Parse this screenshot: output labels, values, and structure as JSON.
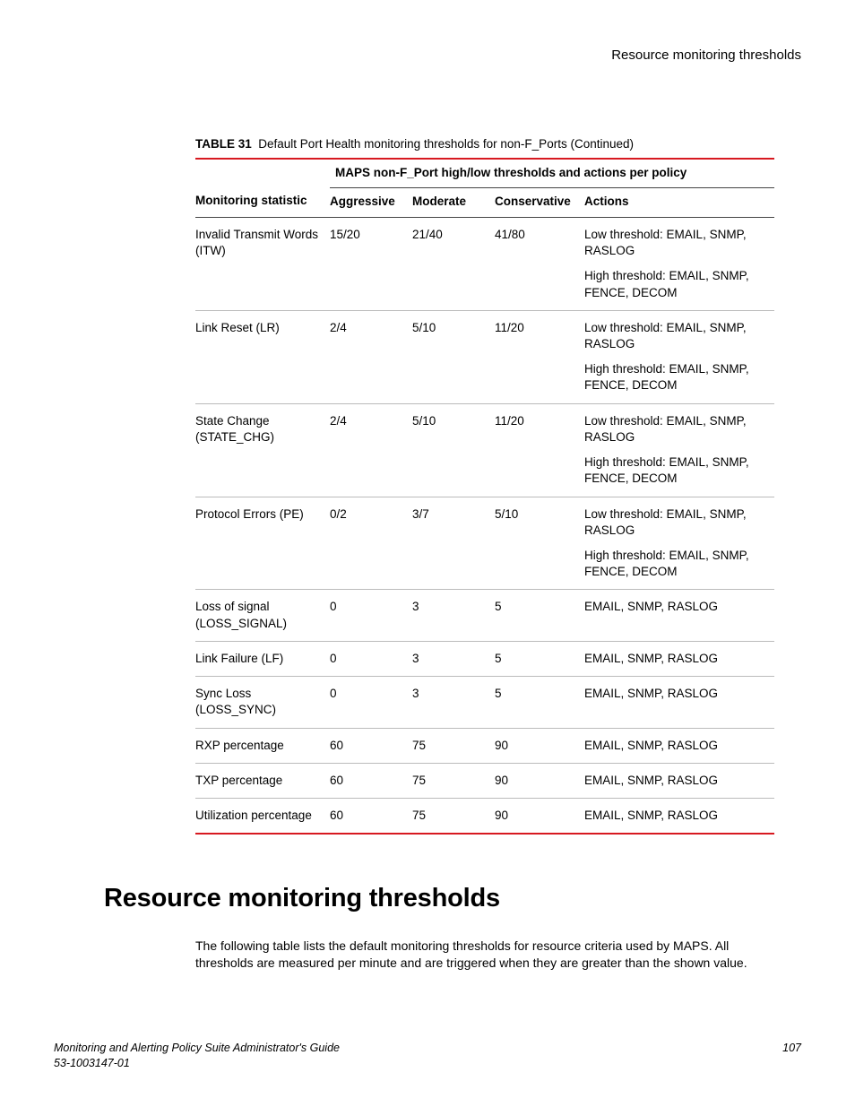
{
  "running_head": "Resource monitoring thresholds",
  "table_caption_label": "TABLE 31",
  "table_caption_text": "Default Port Health monitoring thresholds for non-F_Ports (Continued)",
  "super_header": "MAPS non-F_Port high/low thresholds and actions per policy",
  "columns": {
    "stat": "Monitoring statistic",
    "aggressive": "Aggressive",
    "moderate": "Moderate",
    "conservative": "Conservative",
    "actions": "Actions"
  },
  "actions_two_line": {
    "low": "Low threshold: EMAIL, SNMP, RASLOG",
    "high": "High threshold: EMAIL, SNMP, FENCE, DECOM"
  },
  "actions_single": "EMAIL, SNMP, RASLOG",
  "rows": [
    {
      "stat": "Invalid Transmit Words (ITW)",
      "aggressive": "15/20",
      "moderate": "21/40",
      "conservative": "41/80",
      "two": true
    },
    {
      "stat": "Link Reset (LR)",
      "aggressive": "2/4",
      "moderate": "5/10",
      "conservative": "11/20",
      "two": true
    },
    {
      "stat": "State Change (STATE_CHG)",
      "aggressive": "2/4",
      "moderate": "5/10",
      "conservative": "11/20",
      "two": true
    },
    {
      "stat": "Protocol Errors (PE)",
      "aggressive": "0/2",
      "moderate": "3/7",
      "conservative": "5/10",
      "two": true
    },
    {
      "stat": "Loss of signal (LOSS_SIGNAL)",
      "aggressive": "0",
      "moderate": "3",
      "conservative": "5",
      "two": false
    },
    {
      "stat": "Link Failure (LF)",
      "aggressive": "0",
      "moderate": "3",
      "conservative": "5",
      "two": false
    },
    {
      "stat": "Sync Loss (LOSS_SYNC)",
      "aggressive": "0",
      "moderate": "3",
      "conservative": "5",
      "two": false
    },
    {
      "stat": "RXP percentage",
      "aggressive": "60",
      "moderate": "75",
      "conservative": "90",
      "two": false
    },
    {
      "stat": "TXP percentage",
      "aggressive": "60",
      "moderate": "75",
      "conservative": "90",
      "two": false
    },
    {
      "stat": "Utilization percentage",
      "aggressive": "60",
      "moderate": "75",
      "conservative": "90",
      "two": false
    }
  ],
  "section_heading": "Resource monitoring thresholds",
  "section_body": "The following table lists the default monitoring thresholds for resource criteria used by MAPS. All thresholds are measured per minute and are triggered when they are greater than the shown value.",
  "footer": {
    "title": "Monitoring and Alerting Policy Suite Administrator's Guide",
    "doc_no": "53-1003147-01",
    "page": "107"
  }
}
